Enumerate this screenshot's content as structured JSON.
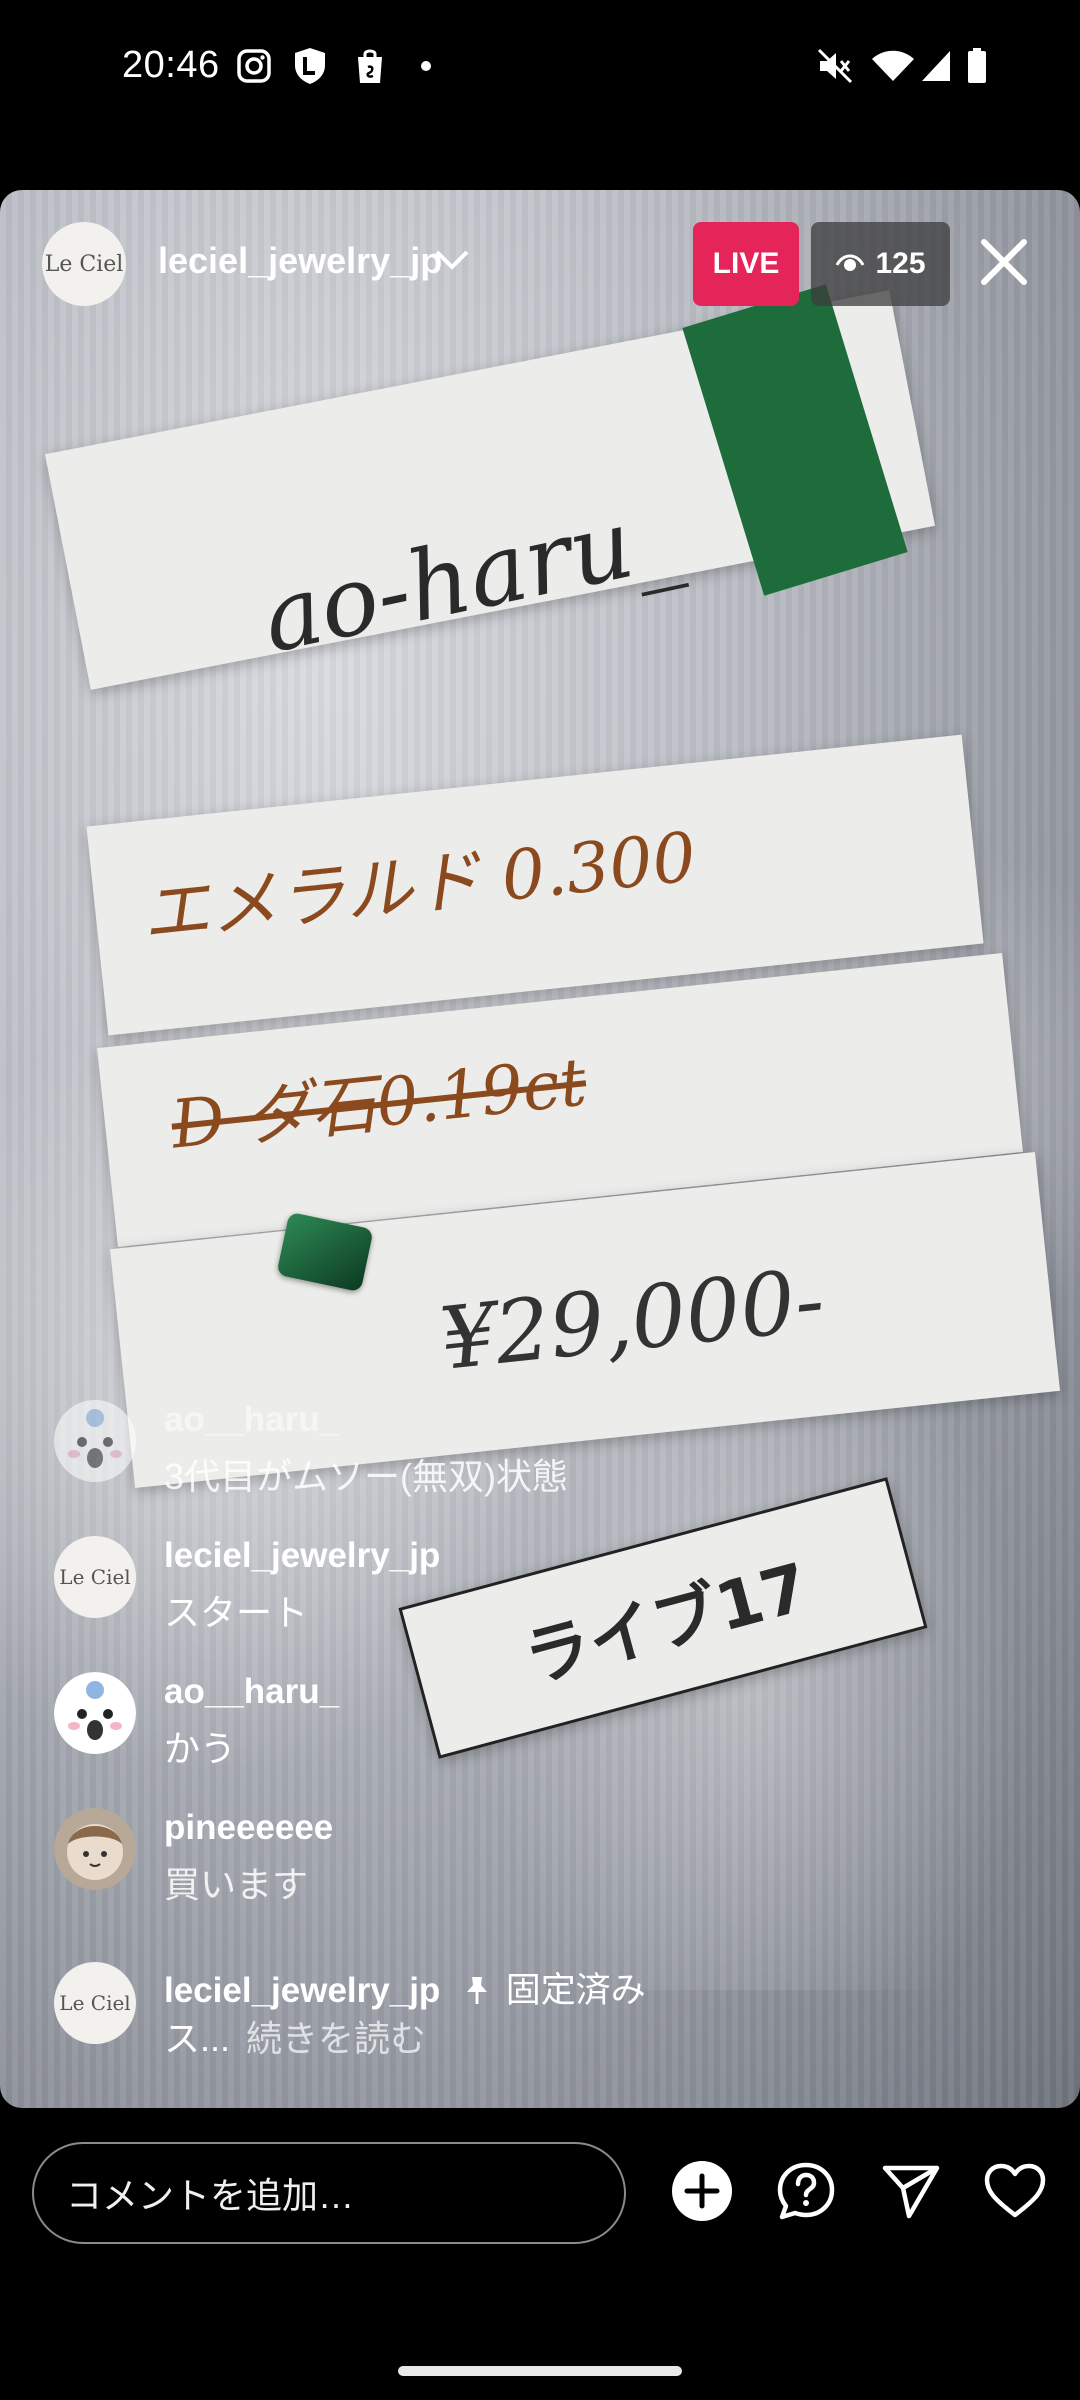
{
  "status_bar": {
    "time": "20:46",
    "left_icons": [
      "instagram-icon",
      "lock-shield-icon",
      "shopping-bag-icon",
      "dot-icon"
    ],
    "right_icons": [
      "mute-icon",
      "wifi-icon",
      "signal-icon",
      "battery-icon"
    ]
  },
  "live": {
    "host_avatar_text": "Le Ciel",
    "host_name": "leciel_jewelry_jp",
    "live_label": "LIVE",
    "viewer_count": "125",
    "accent_color": "#e5245a"
  },
  "video_scene": {
    "tag_text": "ao-haru_",
    "line1": "エメラルド 0.300",
    "line2": "D ダ石0.19ct",
    "price": "¥29,000-",
    "label": "ライブ17"
  },
  "comments": [
    {
      "user": "ao__haru_",
      "text": "3代目がムソー(無双)状態",
      "avatar": "character-avatar",
      "faded": true
    },
    {
      "user": "leciel_jewelry_jp",
      "text": "スタート",
      "avatar": "Le Ciel"
    },
    {
      "user": "ao__haru_",
      "text": "かう",
      "avatar": "character-avatar"
    },
    {
      "user": "pineeeeee",
      "text": "買います",
      "avatar": "round-character-avatar"
    },
    {
      "user": "leciel_jewelry_jp",
      "pinned_label": "固定済み",
      "text_start": "ス...",
      "read_more": "続きを読む",
      "avatar": "Le Ciel"
    }
  ],
  "bottom_bar": {
    "comment_placeholder": "コメントを追加…",
    "icons": [
      "add-icon",
      "question-icon",
      "send-icon",
      "heart-icon"
    ]
  }
}
